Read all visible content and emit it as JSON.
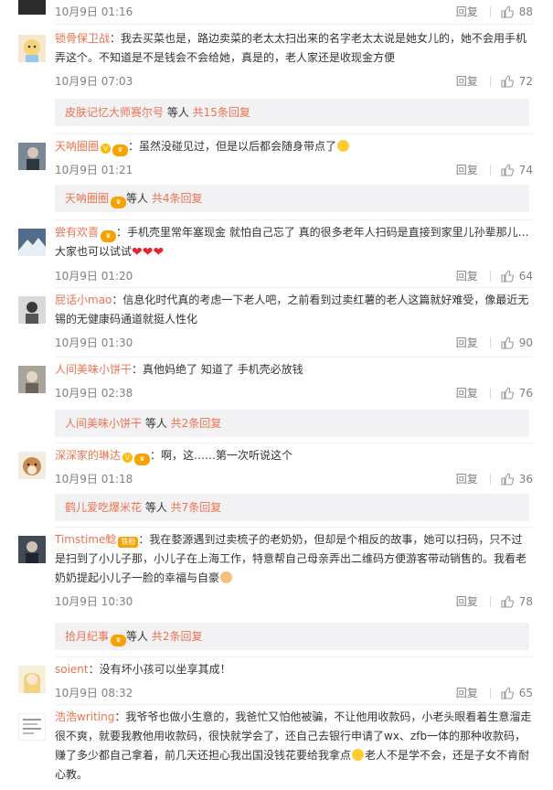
{
  "like_icon": "thumb-up-icon",
  "colors": {
    "link": "#eb7350",
    "muted": "#808080",
    "reply_panel": "#f2f2f5"
  },
  "top": {
    "time": "10月9日 01:16",
    "reply": "回复",
    "likes": "88"
  },
  "comments": [
    {
      "user": "锁骨保卫战",
      "text": "：我去买菜也是，路边卖菜的老太太扫出来的名字老太太说是她女儿的，她不会用手机弄这个。不知道是不是钱会不会给她，真是的，老人家还是收现金方便",
      "time": "10月9日 07:03",
      "reply": "回复",
      "likes": "72",
      "sub": {
        "user": "皮肤记忆大师赛尔号",
        "mid": " 等人 ",
        "count": "共15条回复"
      }
    },
    {
      "user": "天呐圈圈",
      "text": "：虽然没碰见过，但是以后都会随身带点了",
      "time": "10月9日 01:21",
      "reply": "回复",
      "likes": "74",
      "sub": {
        "user": "天呐圈圈",
        "mid": "等人 ",
        "count": "共4条回复"
      }
    },
    {
      "user": "尝有欢喜",
      "text": "：手机壳里常年塞现金 就怕自己忘了 真的很多老年人扫码是直接到家里儿孙辈那儿… 大家也可以试试",
      "time": "10月9日 01:20",
      "reply": "回复",
      "likes": "64"
    },
    {
      "user": "屁话小mao",
      "text": "：信息化时代真的考虑一下老人吧，之前看到过卖红薯的老人这篇就好难受，像最近无锡的无健康码通道就挺人性化",
      "time": "10月9日 01:30",
      "reply": "回复",
      "likes": "90"
    },
    {
      "user": "人间美味小饼干",
      "text": "：真他妈绝了 知道了 手机壳必放钱",
      "time": "10月9日 02:38",
      "reply": "回复",
      "likes": "76",
      "sub": {
        "user": "人间美味小饼干",
        "mid": " 等人 ",
        "count": "共2条回复"
      }
    },
    {
      "user": "深深家的琳达",
      "text": "：啊，这……第一次听说这个",
      "time": "10月9日 01:18",
      "reply": "回复",
      "likes": "36",
      "sub": {
        "user": "鹤儿爱吃爆米花",
        "mid": " 等人 ",
        "count": "共7条回复"
      }
    },
    {
      "user": "Timstime鲶",
      "badge": "铁粉",
      "text": "：我在婺源遇到过卖梳子的老奶奶，但却是个相反的故事，她可以扫码，只不过是扫到了小儿子那，小儿子在上海工作，特意帮自己母亲弄出二维码方便游客带动销售的。我看老奶奶提起小儿子一脸的幸福与自豪",
      "time": "10月9日 10:30",
      "reply": "回复",
      "likes": "78",
      "sub": {
        "user": "拾月纪事",
        "mid": "等人 ",
        "count": "共2条回复"
      }
    },
    {
      "user": "soient",
      "text": "：没有坏小孩可以坐享其成！",
      "time": "10月9日 08:32",
      "reply": "回复",
      "likes": "65"
    },
    {
      "user": "浩浩writing",
      "text": "：我爷爷也做小生意的，我爸忙又怕他被骗，不让他用收款码，小老头眼看着生意溜走很不爽，就要我教他用收款码，很快就学会了，还自己去银行申请了wx、zfb一体的那种收款码，赚了多少都自己拿着，前几天还担心我出国没钱花要给我拿点",
      "text2": "老人不是学不会，还是子女不肯耐心教。"
    }
  ]
}
